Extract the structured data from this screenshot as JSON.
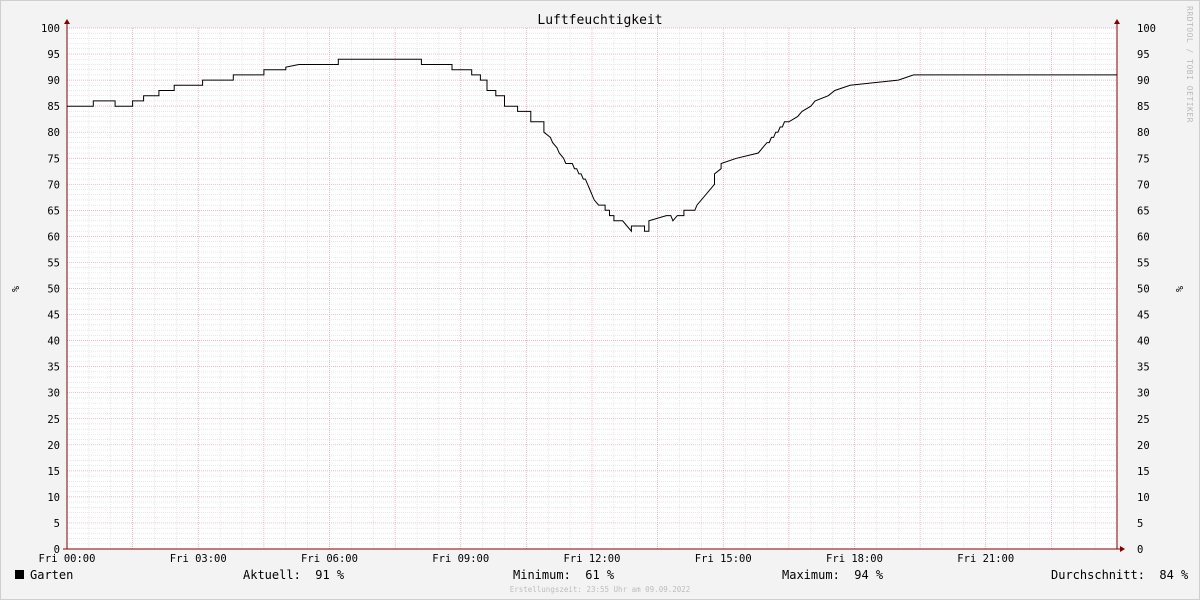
{
  "chart_data": {
    "type": "line",
    "title": "Luftfeuchtigkeit",
    "ylabel": "%",
    "ylim": [
      0,
      100
    ],
    "y_ticks": [
      "0",
      "5",
      "10",
      "15",
      "20",
      "25",
      "30",
      "35",
      "40",
      "45",
      "50",
      "55",
      "60",
      "65",
      "70",
      "75",
      "80",
      "85",
      "90",
      "95",
      "100"
    ],
    "x_tick_labels": [
      "Fri 00:00",
      "Fri 03:00",
      "Fri 06:00",
      "Fri 09:00",
      "Fri 12:00",
      "Fri 15:00",
      "Fri 18:00",
      "Fri 21:00"
    ],
    "x_tick_hours": [
      0,
      3,
      6,
      9,
      12,
      15,
      18,
      21
    ],
    "xlim_hours": [
      0,
      24
    ],
    "grid": true,
    "line_color": "#000000",
    "grid_major_color": "#e6a3b4",
    "grid_minor_color": "#d9d9d9",
    "axis_color": "#800000",
    "series": [
      {
        "name": "Garten",
        "x_hours": [
          0,
          0.6,
          0.6,
          1.1,
          1.1,
          1.5,
          1.5,
          1.75,
          1.75,
          2.1,
          2.1,
          2.45,
          2.45,
          3.1,
          3.1,
          3.8,
          3.8,
          4.5,
          4.5,
          5.0,
          5.0,
          5.3,
          5.3,
          6.2,
          6.2,
          8.1,
          8.1,
          8.8,
          8.8,
          9.25,
          9.25,
          9.45,
          9.45,
          9.6,
          9.6,
          9.8,
          9.8,
          10.0,
          10.0,
          10.3,
          10.3,
          10.6,
          10.6,
          10.9,
          10.9,
          11.05,
          11.1,
          11.2,
          11.25,
          11.35,
          11.4,
          11.5,
          11.55,
          11.6,
          11.65,
          11.7,
          11.75,
          11.8,
          11.85,
          11.9,
          11.95,
          12.0,
          12.05,
          12.15,
          12.15,
          12.3,
          12.3,
          12.4,
          12.4,
          12.5,
          12.5,
          12.6,
          12.6,
          12.7,
          12.7,
          12.8,
          12.8,
          12.9,
          12.9,
          13.2,
          13.2,
          13.3,
          13.3,
          13.7,
          13.7,
          13.8,
          13.8,
          13.85,
          13.85,
          13.95,
          13.95,
          14.1,
          14.1,
          14.35,
          14.35,
          14.4,
          14.4,
          14.8,
          14.8,
          14.95,
          14.95,
          15.3,
          15.3,
          15.8,
          15.8,
          15.9,
          15.9,
          16.0,
          16.05,
          16.1,
          16.15,
          16.2,
          16.25,
          16.3,
          16.35,
          16.4,
          16.4,
          16.5,
          16.5,
          16.7,
          16.7,
          16.8,
          16.8,
          17.0,
          17.0,
          17.1,
          17.1,
          17.4,
          17.4,
          17.55,
          17.55,
          17.9,
          17.9,
          19.0,
          19.0,
          19.35,
          19.35,
          19.7,
          19.7,
          20.0,
          20.0,
          20.3,
          20.3,
          20.5,
          20.5,
          21.0,
          21.0,
          21.45,
          21.45,
          22.4,
          22.4,
          23.3,
          23.3,
          24.0
        ],
        "values": [
          85,
          85,
          86,
          86,
          85,
          85,
          86,
          86,
          87,
          87,
          88,
          88,
          89,
          89,
          90,
          90,
          91,
          91,
          92,
          92,
          92.5,
          93,
          93,
          93,
          94,
          94,
          93,
          93,
          92,
          92,
          91,
          91,
          90,
          90,
          88,
          88,
          87,
          87,
          85,
          85,
          84,
          84,
          82,
          82,
          80,
          79,
          78,
          77,
          76,
          75,
          74,
          74,
          74,
          73,
          73,
          72,
          72,
          71,
          71,
          70,
          69,
          68,
          67,
          66,
          66,
          66,
          65,
          65,
          64,
          64,
          63,
          63,
          63,
          63,
          63,
          62,
          62,
          61,
          62,
          62,
          61,
          61,
          63,
          64,
          64,
          64,
          64,
          63,
          63,
          64,
          64,
          64,
          65,
          65,
          65,
          66,
          66,
          70,
          72,
          73,
          74,
          75,
          75,
          76,
          76,
          77,
          77,
          78,
          78,
          79,
          79,
          80,
          80,
          81,
          81,
          82,
          82,
          82,
          82,
          83,
          83,
          84,
          84,
          85,
          85,
          86,
          86,
          87,
          87,
          88,
          88,
          89,
          89,
          90,
          90,
          91,
          91,
          91,
          91,
          91,
          91,
          91,
          91,
          91,
          91,
          91,
          91,
          91,
          91,
          91,
          91,
          91,
          91,
          91
        ]
      }
    ]
  },
  "watermark": "RRDTOOL / TOBI OETIKER",
  "legend": {
    "series_name": "Garten",
    "aktuell_label": "Aktuell:",
    "aktuell_value": "91 %",
    "minimum_label": "Minimum:",
    "minimum_value": "61 %",
    "maximum_label": "Maximum:",
    "maximum_value": "94 %",
    "durchschnitt_label": "Durchschnitt:",
    "durchschnitt_value": "84 %"
  },
  "footer": "Erstellungszeit: 23:55 Uhr am 09.09.2022"
}
